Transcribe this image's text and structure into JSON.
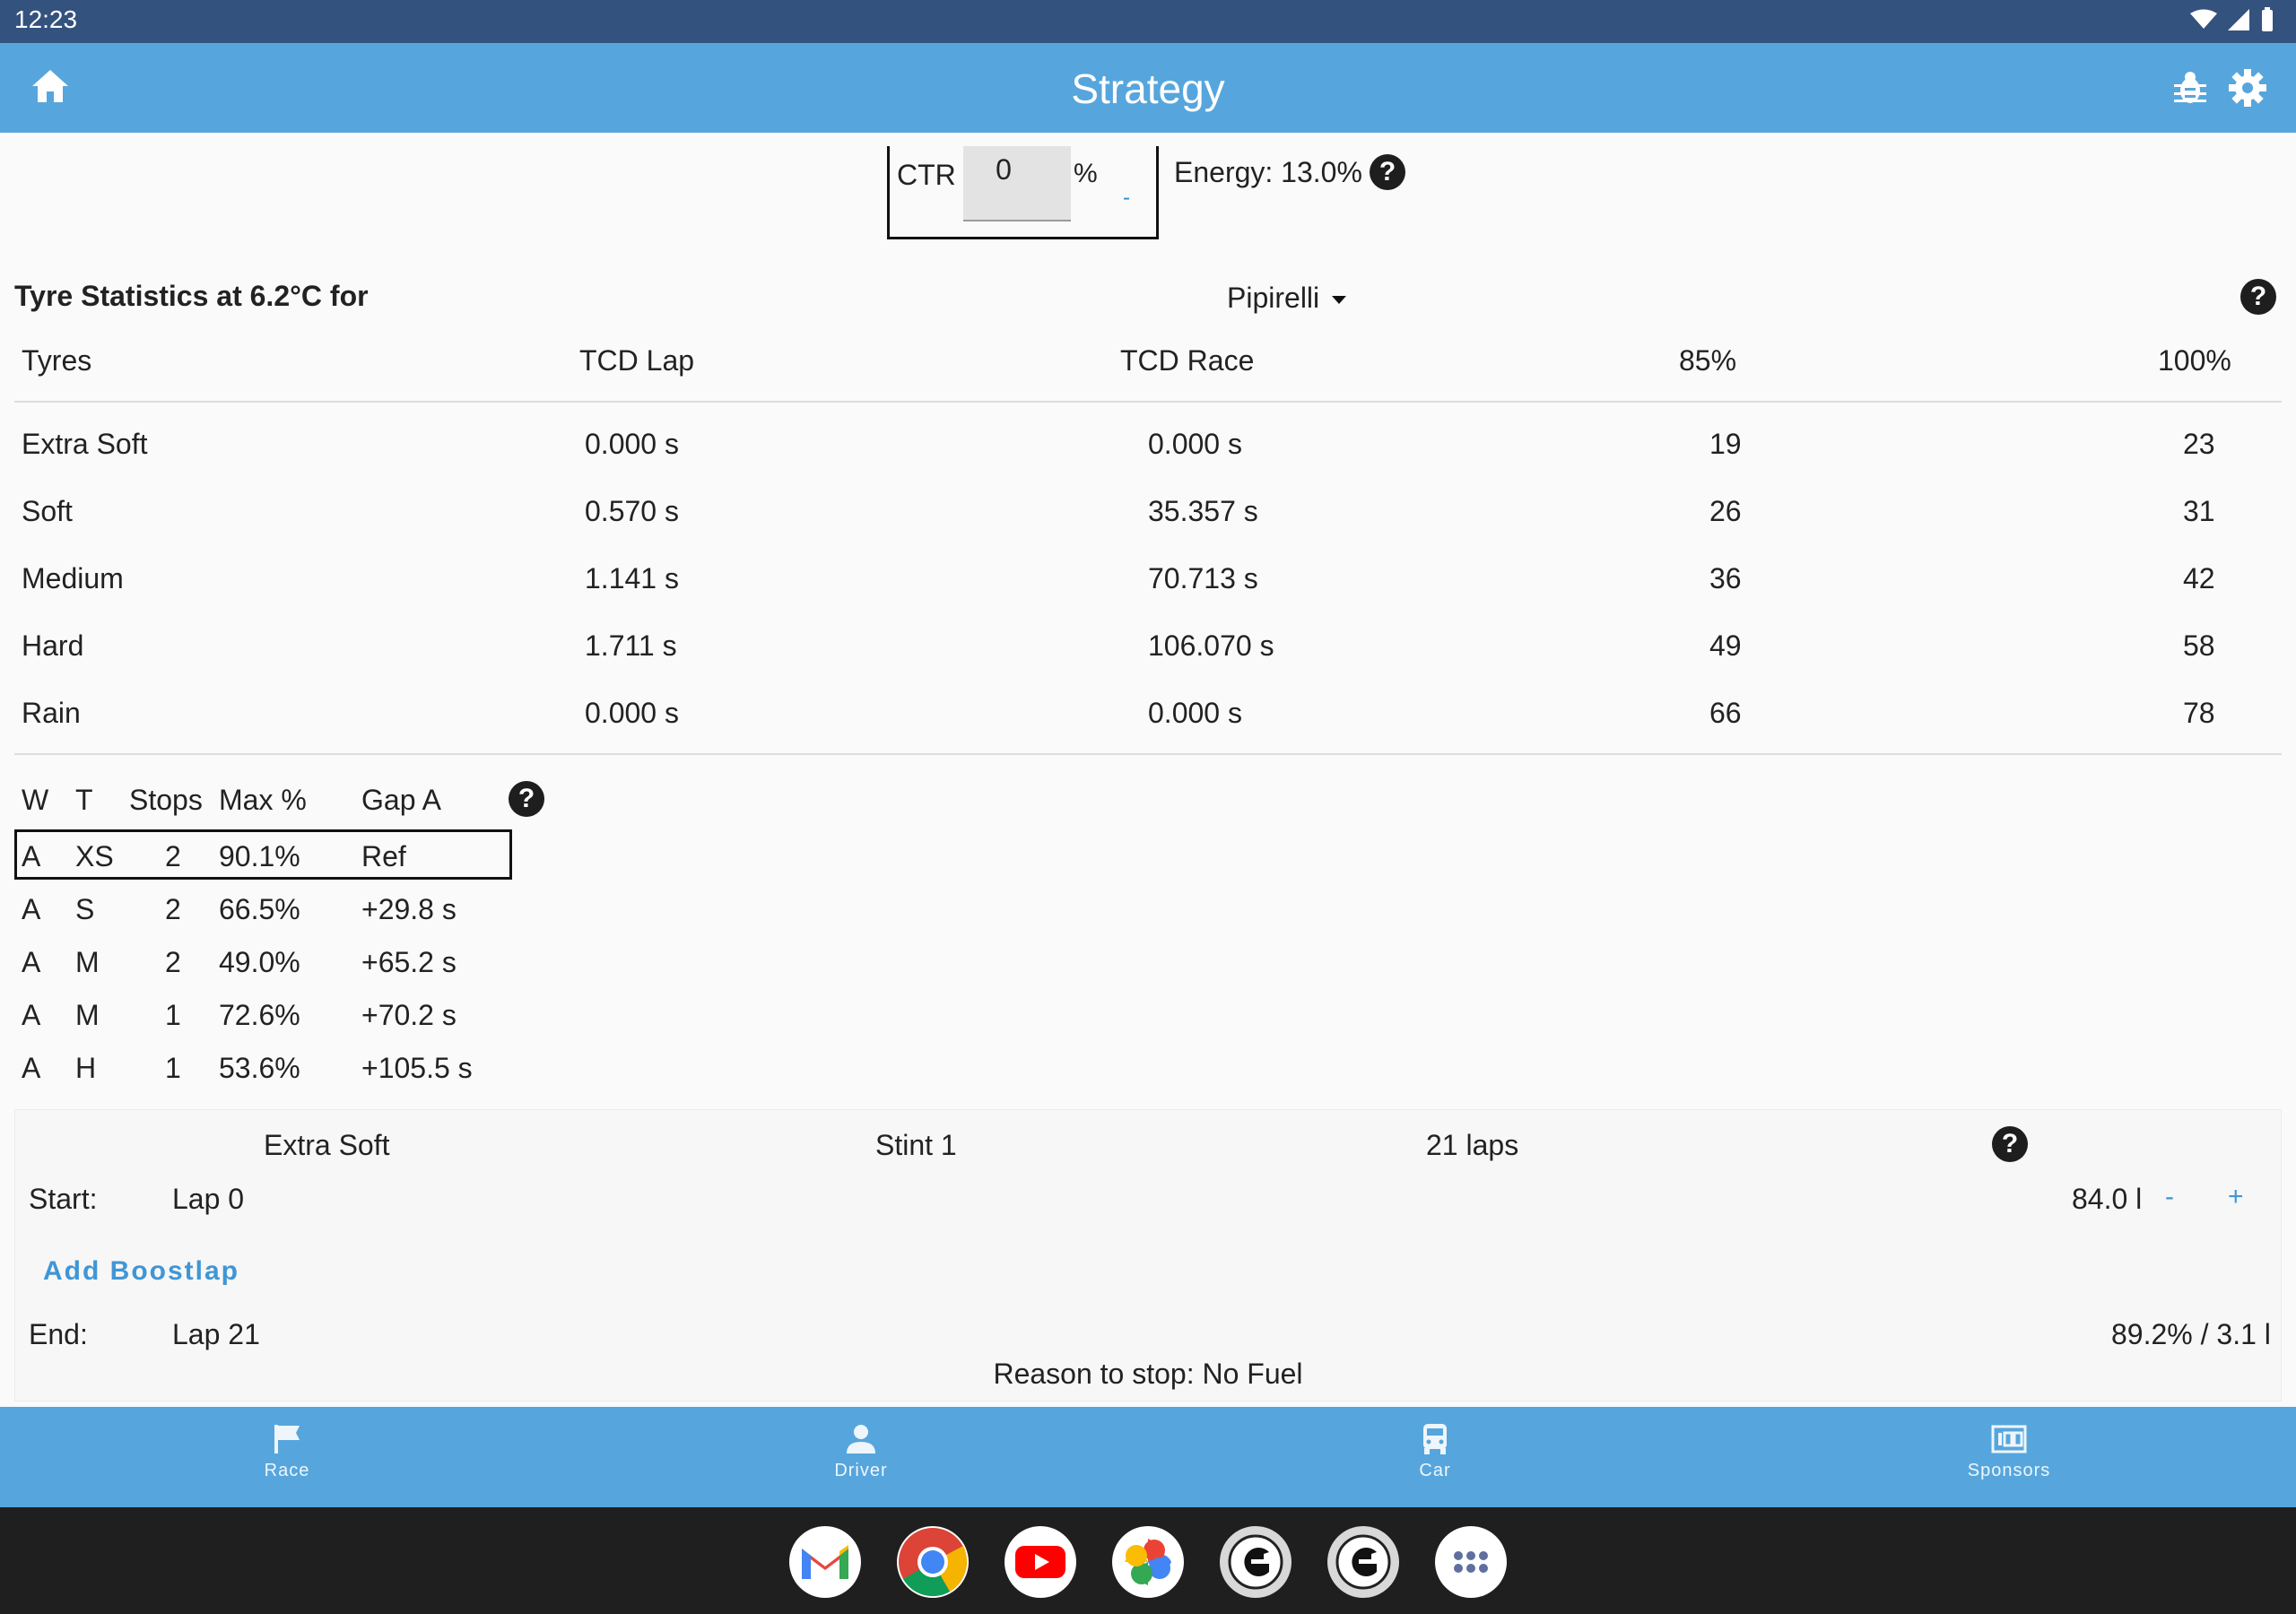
{
  "status_bar": {
    "time": "12:23"
  },
  "app_bar": {
    "title": "Strategy"
  },
  "ctr": {
    "label": "CTR",
    "value": "0",
    "unit": "%",
    "decrement": "-"
  },
  "energy": {
    "label": "Energy: 13.0%"
  },
  "tyre_stats": {
    "title": "Tyre Statistics at 6.2°C for",
    "supplier": "Pipirelli",
    "headers": [
      "Tyres",
      "TCD Lap",
      "TCD Race",
      "85%",
      "100%"
    ],
    "rows": [
      [
        "Extra Soft",
        "0.000 s",
        "0.000 s",
        "19",
        "23"
      ],
      [
        "Soft",
        "0.570 s",
        "35.357 s",
        "26",
        "31"
      ],
      [
        "Medium",
        "1.141 s",
        "70.713 s",
        "36",
        "42"
      ],
      [
        "Hard",
        "1.711 s",
        "106.070 s",
        "49",
        "58"
      ],
      [
        "Rain",
        "0.000 s",
        "0.000 s",
        "66",
        "78"
      ]
    ]
  },
  "strategies": {
    "headers": [
      "W",
      "T",
      "Stops",
      "Max %",
      "Gap A"
    ],
    "rows": [
      [
        "A",
        "XS",
        "2",
        "90.1%",
        "Ref"
      ],
      [
        "A",
        "S",
        "2",
        "66.5%",
        "+29.8 s"
      ],
      [
        "A",
        "M",
        "2",
        "49.0%",
        "+65.2 s"
      ],
      [
        "A",
        "M",
        "1",
        "72.6%",
        "+70.2 s"
      ],
      [
        "A",
        "H",
        "1",
        "53.6%",
        "+105.5 s"
      ]
    ],
    "selected_index": 0
  },
  "stint": {
    "tyre": "Extra Soft",
    "name": "Stint 1",
    "laps": "21 laps",
    "start_label": "Start:",
    "start_value": "Lap 0",
    "fuel": "84.0 l",
    "minus": "-",
    "plus": "+",
    "add_boost": "Add Boostlap",
    "end_label": "End:",
    "end_value": "Lap 21",
    "end_stats": "89.2% / 3.1 l",
    "reason": "Reason to stop: No Fuel"
  },
  "bottom_nav": {
    "items": [
      {
        "label": "Race",
        "icon": "flag-icon"
      },
      {
        "label": "Driver",
        "icon": "person-icon"
      },
      {
        "label": "Car",
        "icon": "car-icon"
      },
      {
        "label": "Sponsors",
        "icon": "scoreboard-icon"
      }
    ]
  },
  "taskbar": {
    "apps": [
      "gmail-icon",
      "chrome-icon",
      "youtube-icon",
      "photos-icon",
      "game-app-icon",
      "game-app-2-icon",
      "app-drawer-icon"
    ]
  },
  "colors": {
    "status_bar": "#34527e",
    "app_bar": "#56a6dd",
    "accent": "#3f96d6",
    "taskbar": "#1f1f1f"
  }
}
